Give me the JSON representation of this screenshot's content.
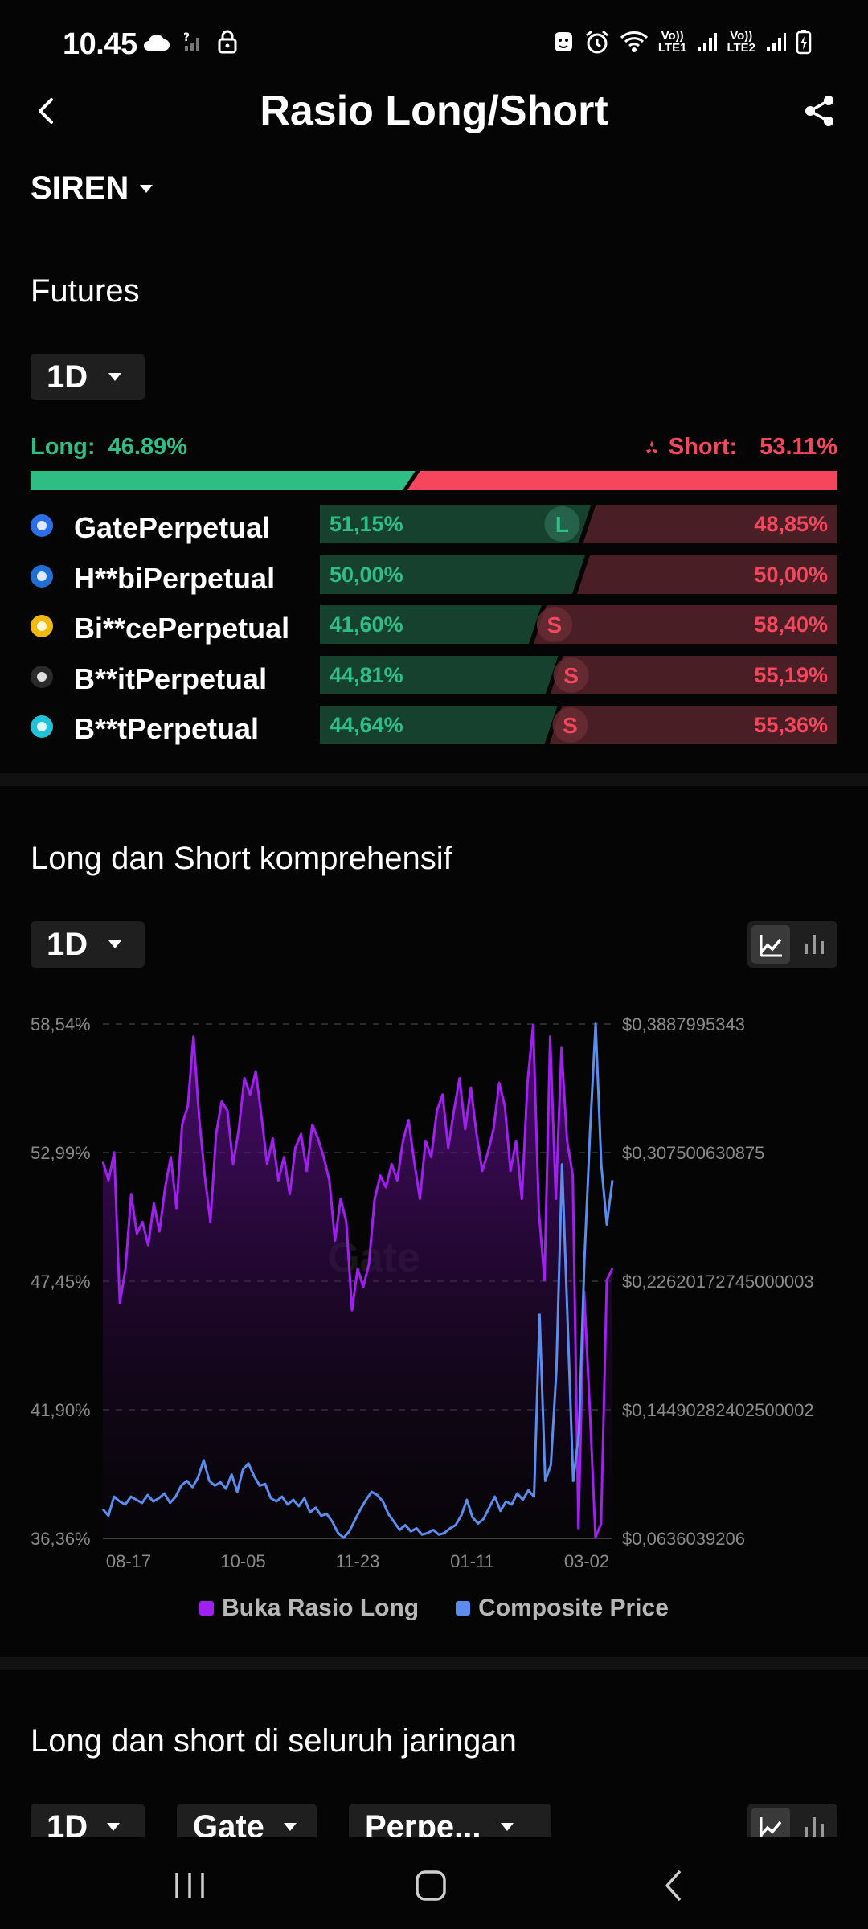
{
  "status_bar": {
    "time": "10.45",
    "net1": [
      "Vo))",
      "LTE1"
    ],
    "net2": [
      "Vo))",
      "LTE2"
    ]
  },
  "header": {
    "title": "Rasio Long/Short",
    "back_icon": "chevron-left-icon",
    "share_icon": "share-icon"
  },
  "coin": {
    "name": "SIREN"
  },
  "futures": {
    "title": "Futures",
    "period": "1D",
    "long_label": "Long:",
    "long_value": "46.89%",
    "short_label": "Short:",
    "short_value": "53.11%",
    "long_fraction": 0.4689,
    "colors": {
      "long": "#2ebd85",
      "short": "#f6465d",
      "long_dark": "#16412f",
      "short_dark": "#4a1e25"
    },
    "exchanges": [
      {
        "name": "GatePerpetual",
        "long": "51,15%",
        "short": "48,85%",
        "long_pct": 51.15,
        "badge": "L",
        "icon": "gate-logo-icon",
        "icon_color": "#2c6ee8"
      },
      {
        "name": "H**biPerpetual",
        "long": "50,00%",
        "short": "50,00%",
        "long_pct": 50.0,
        "badge": "",
        "icon": "huobi-logo-icon",
        "icon_color": "#1f6fd6"
      },
      {
        "name": "Bi**cePerpetual",
        "long": "41,60%",
        "short": "58,40%",
        "long_pct": 41.6,
        "badge": "S",
        "icon": "binance-logo-icon",
        "icon_color": "#f0b90b"
      },
      {
        "name": "B**itPerpetual",
        "long": "44,81%",
        "short": "55,19%",
        "long_pct": 44.81,
        "badge": "S",
        "icon": "bybit-logo-icon",
        "icon_color": "#2a2a2a"
      },
      {
        "name": "B**tPerpetual",
        "long": "44,64%",
        "short": "55,36%",
        "long_pct": 44.64,
        "badge": "S",
        "icon": "bitget-logo-icon",
        "icon_color": "#1fc4d8"
      }
    ]
  },
  "comprehensive": {
    "title": "Long dan Short komprehensif",
    "period": "1D",
    "toggle_icons": [
      "line-chart-icon",
      "bar-chart-icon"
    ],
    "watermark": "Gate"
  },
  "chart_data": {
    "type": "line",
    "x_ticks": [
      "08-17",
      "10-05",
      "11-23",
      "01-11",
      "03-02"
    ],
    "y_left_ticks": [
      "58,54%",
      "52,99%",
      "47,45%",
      "41,90%",
      "36,36%"
    ],
    "y_right_ticks": [
      "$0,3887995343",
      "$0,307500630875",
      "$0,22620172745000003",
      "$0,14490282402500002",
      "$0,0636039206"
    ],
    "ylim_left": [
      36.36,
      58.54
    ],
    "ylim_right": [
      0.0636039206,
      0.3887995343
    ],
    "grid": true,
    "legend_position": "bottom",
    "series": [
      {
        "name": "Buka Rasio Long",
        "axis": "left",
        "color": "#a020f0",
        "values": [
          52.6,
          51.8,
          53.0,
          46.5,
          48.0,
          51.2,
          49.5,
          50.0,
          49.0,
          50.8,
          49.6,
          51.5,
          52.8,
          50.6,
          54.2,
          55.0,
          58.0,
          54.5,
          52.0,
          50.0,
          53.8,
          55.2,
          54.8,
          52.5,
          54.0,
          56.2,
          55.5,
          56.5,
          54.6,
          52.5,
          53.6,
          51.8,
          52.8,
          51.2,
          53.2,
          53.8,
          52.2,
          54.2,
          53.6,
          52.8,
          51.8,
          49.2,
          51.0,
          50.0,
          46.2,
          48.0,
          47.2,
          48.2,
          51.0,
          52.0,
          51.5,
          52.5,
          51.8,
          53.5,
          54.4,
          52.6,
          51.0,
          53.5,
          52.8,
          54.8,
          55.5,
          53.2,
          54.8,
          56.2,
          54.0,
          55.8,
          53.8,
          52.2,
          53.0,
          54.0,
          56.0,
          55.0,
          52.2,
          53.5,
          51.0,
          56.0,
          58.5,
          50.5,
          47.5,
          58.0,
          51.0,
          57.5,
          53.5,
          52.0,
          36.8,
          47.0,
          42.0,
          36.4,
          37.0,
          47.5,
          48.0
        ]
      },
      {
        "name": "Composite Price",
        "axis": "right",
        "color": "#5b8dee",
        "values": [
          0.082,
          0.078,
          0.09,
          0.087,
          0.085,
          0.09,
          0.088,
          0.086,
          0.091,
          0.087,
          0.089,
          0.092,
          0.086,
          0.09,
          0.097,
          0.1,
          0.096,
          0.102,
          0.113,
          0.1,
          0.097,
          0.099,
          0.095,
          0.104,
          0.093,
          0.107,
          0.111,
          0.103,
          0.097,
          0.098,
          0.089,
          0.087,
          0.09,
          0.085,
          0.088,
          0.084,
          0.089,
          0.08,
          0.083,
          0.078,
          0.079,
          0.074,
          0.067,
          0.064,
          0.068,
          0.075,
          0.082,
          0.088,
          0.093,
          0.091,
          0.087,
          0.079,
          0.074,
          0.069,
          0.072,
          0.068,
          0.07,
          0.066,
          0.067,
          0.069,
          0.066,
          0.067,
          0.07,
          0.072,
          0.078,
          0.088,
          0.077,
          0.073,
          0.076,
          0.083,
          0.09,
          0.081,
          0.087,
          0.085,
          0.092,
          0.088,
          0.094,
          0.09,
          0.205,
          0.1,
          0.11,
          0.17,
          0.3,
          0.2,
          0.1,
          0.13,
          0.24,
          0.32,
          0.389,
          0.3,
          0.262,
          0.29
        ]
      }
    ]
  },
  "network": {
    "title": "Long dan short di seluruh jaringan",
    "period": "1D",
    "exchange": "Gate",
    "market": "Perpe..."
  },
  "navbar": {
    "icons": [
      "recent-apps-icon",
      "home-icon",
      "back-icon"
    ]
  }
}
